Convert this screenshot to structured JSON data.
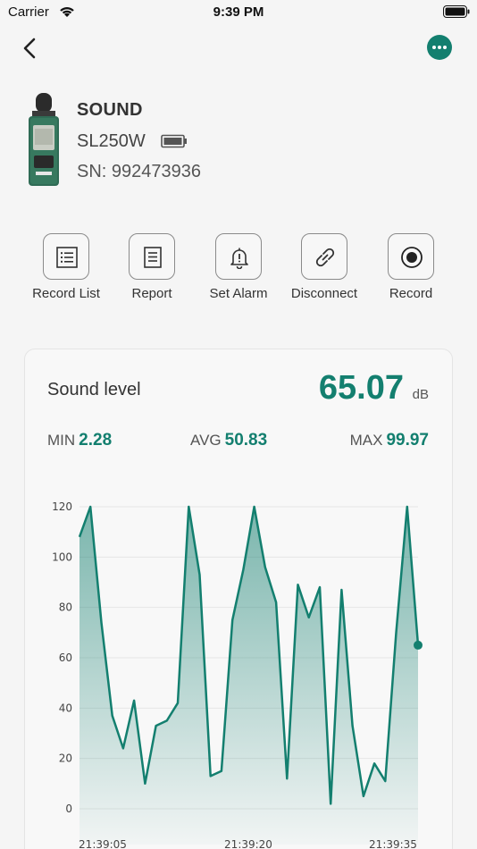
{
  "status_bar": {
    "carrier": "Carrier",
    "time": "9:39 PM"
  },
  "nav": {
    "back_icon": "chevron-left-icon",
    "more_icon": "ellipsis-icon"
  },
  "device": {
    "name": "SOUND",
    "model": "SL250W",
    "serial": "SN: 992473936",
    "battery_icon": "battery-full-icon"
  },
  "actions": [
    {
      "label": "Record List",
      "icon": "list-icon"
    },
    {
      "label": "Report",
      "icon": "document-icon"
    },
    {
      "label": "Set Alarm",
      "icon": "bell-alert-icon"
    },
    {
      "label": "Disconnect",
      "icon": "broken-link-icon"
    },
    {
      "label": "Record",
      "icon": "record-icon"
    }
  ],
  "reading": {
    "title": "Sound level",
    "value": "65.07",
    "unit": "dB",
    "min_label": "MIN",
    "min_value": "2.28",
    "avg_label": "AVG",
    "avg_value": "50.83",
    "max_label": "MAX",
    "max_value": "99.97"
  },
  "colors": {
    "accent": "#137f6f"
  },
  "chart_data": {
    "type": "area",
    "y_ticks": [
      "120",
      "100",
      "80",
      "60",
      "40",
      "20",
      "0"
    ],
    "ylim": [
      0,
      120
    ],
    "x_tick_labels": [
      "21:39:05",
      "21:39:20",
      "21:39:35"
    ],
    "values": [
      108,
      120,
      74,
      37,
      24,
      43,
      10,
      33,
      35,
      42,
      120,
      93,
      13,
      15,
      75,
      95,
      120,
      96,
      82,
      12,
      89,
      76,
      88,
      2,
      87,
      33,
      5,
      18,
      11,
      70,
      120,
      65
    ],
    "last_point_marker": true
  }
}
